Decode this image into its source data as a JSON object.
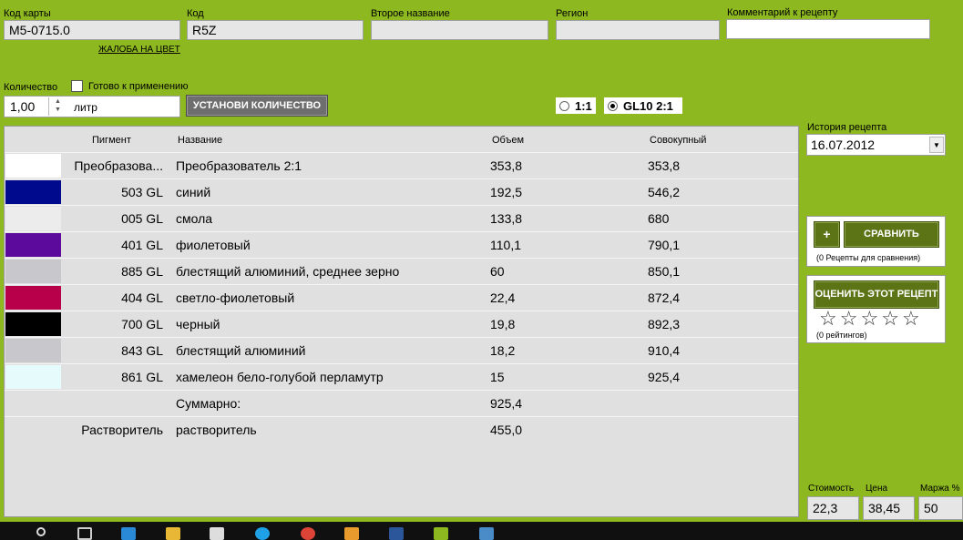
{
  "card": {
    "code_label": "Код карты",
    "code_value": "M5-0715.0",
    "complaint_link": "ЖАЛОБА НА ЦВЕТ",
    "kod_label": "Код",
    "kod_value": "R5Z",
    "second_name_label": "Второе название",
    "second_name_value": "",
    "region_label": "Регион",
    "region_value": "",
    "comment_label": "Комментарий к рецепту",
    "comment_value": ""
  },
  "quantity": {
    "label": "Количество",
    "value": "1,00",
    "unit": "литр",
    "ready_label": "Готово к применению",
    "set_button": "УСТАНОВИ КОЛИЧЕСТВО"
  },
  "ratio": {
    "options": [
      {
        "label": "1:1",
        "selected": false
      },
      {
        "label": "GL10 2:1",
        "selected": true
      }
    ]
  },
  "table": {
    "headers": {
      "pigment": "Пигмент",
      "name": "Название",
      "volume": "Объем",
      "cumulative": "Совокупный"
    },
    "rows": [
      {
        "color": "#ffffff",
        "pigment": "Преобразова...",
        "name": "Преобразователь 2:1",
        "volume": "353,8",
        "cumulative": "353,8"
      },
      {
        "color": "#000a8c",
        "pigment": "503 GL",
        "name": "синий",
        "volume": "192,5",
        "cumulative": "546,2"
      },
      {
        "color": "#ececec",
        "pigment": "005 GL",
        "name": "смола",
        "volume": "133,8",
        "cumulative": "680"
      },
      {
        "color": "#5c0a9c",
        "pigment": "401 GL",
        "name": "фиолетовый",
        "volume": "110,1",
        "cumulative": "790,1"
      },
      {
        "color": "#c8c8cc",
        "pigment": "885 GL",
        "name": "блестящий алюминий, среднее зерно",
        "volume": "60",
        "cumulative": "850,1"
      },
      {
        "color": "#b8004a",
        "pigment": "404 GL",
        "name": "светло-фиолетовый",
        "volume": "22,4",
        "cumulative": "872,4"
      },
      {
        "color": "#000000",
        "pigment": "700 GL",
        "name": "черный",
        "volume": "19,8",
        "cumulative": "892,3"
      },
      {
        "color": "#c8c8cc",
        "pigment": "843 GL",
        "name": "блестящий алюминий",
        "volume": "18,2",
        "cumulative": "910,4"
      },
      {
        "color": "#e6fbfc",
        "pigment": "861 GL",
        "name": "хамелеон бело-голубой перламутр",
        "volume": "15",
        "cumulative": "925,4"
      },
      {
        "color": "",
        "pigment": "",
        "name": "Суммарно:",
        "volume": "925,4",
        "cumulative": ""
      },
      {
        "color": "",
        "pigment": "Растворитель",
        "name": "растворитель",
        "volume": "455,0",
        "cumulative": ""
      }
    ]
  },
  "history": {
    "label": "История рецепта",
    "value": "16.07.2012"
  },
  "compare": {
    "plus": "+",
    "button": "СРАВНИТЬ",
    "caption": "(0 Рецепты для сравнения)"
  },
  "rating": {
    "button": "ОЦЕНИТЬ ЭТОТ РЕЦЕПТ",
    "stars": 0,
    "max_stars": 5,
    "caption": "(0 рейтингов)"
  },
  "pricing": {
    "cost_label": "Стоимость",
    "cost_value": "22,3",
    "price_label": "Цена",
    "price_value": "38,45",
    "margin_label": "Маржа %",
    "margin_value": "50"
  }
}
